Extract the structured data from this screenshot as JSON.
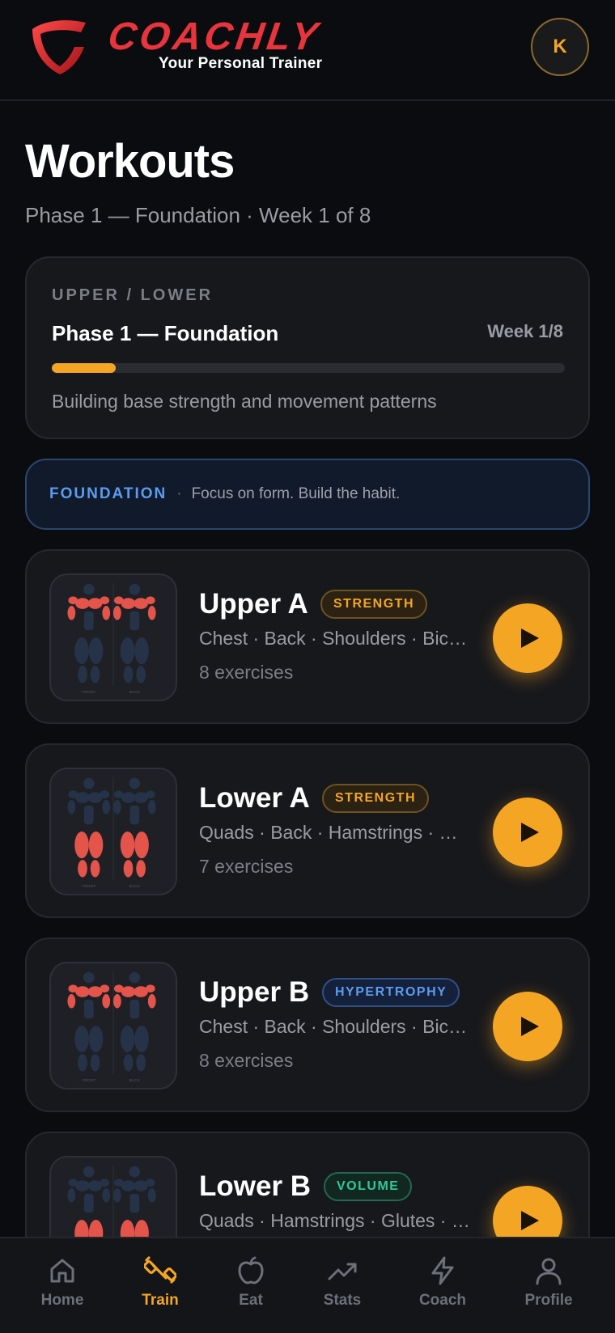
{
  "brand": {
    "name": "COACHLY",
    "tagline": "Your Personal Trainer",
    "color": "#e8343c"
  },
  "user": {
    "initial": "K"
  },
  "page": {
    "title": "Workouts",
    "subtitle": "Phase 1 — Foundation · Week 1 of 8"
  },
  "program": {
    "split": "UPPER / LOWER",
    "phase_name": "Phase 1 — Foundation",
    "week_label": "Week 1/8",
    "progress": 0.125,
    "description": "Building base strength and movement patterns"
  },
  "banner": {
    "tag": "FOUNDATION",
    "separator": "·",
    "text": "Focus on form. Build the habit."
  },
  "workouts": [
    {
      "name": "Upper A",
      "badge": "STRENGTH",
      "badge_type": "strength",
      "muscles": "Chest · Back · Shoulders · Biceps · Triceps",
      "count": "8 exercises"
    },
    {
      "name": "Lower A",
      "badge": "STRENGTH",
      "badge_type": "strength",
      "muscles": "Quads · Back · Hamstrings · Glutes · Calves",
      "count": "7 exercises"
    },
    {
      "name": "Upper B",
      "badge": "HYPERTROPHY",
      "badge_type": "hypertrophy",
      "muscles": "Chest · Back · Shoulders · Biceps · Triceps",
      "count": "8 exercises"
    },
    {
      "name": "Lower B",
      "badge": "VOLUME",
      "badge_type": "volume",
      "muscles": "Quads · Hamstrings · Glutes · Calves",
      "count": ""
    }
  ],
  "thumb_labels": {
    "front": "FRONT",
    "back": "BACK"
  },
  "nav": [
    {
      "label": "Home",
      "icon": "home-icon",
      "active": false
    },
    {
      "label": "Train",
      "icon": "dumbbell-icon",
      "active": true
    },
    {
      "label": "Eat",
      "icon": "apple-icon",
      "active": false
    },
    {
      "label": "Stats",
      "icon": "trending-up-icon",
      "active": false
    },
    {
      "label": "Coach",
      "icon": "lightning-icon",
      "active": false
    },
    {
      "label": "Profile",
      "icon": "user-icon",
      "active": false
    }
  ],
  "colors": {
    "accent": "#f5a524",
    "blue": "#5b9cf0",
    "green": "#2ec99a",
    "muscle_active": "#e5544a",
    "muscle_inactive": "#263248"
  }
}
